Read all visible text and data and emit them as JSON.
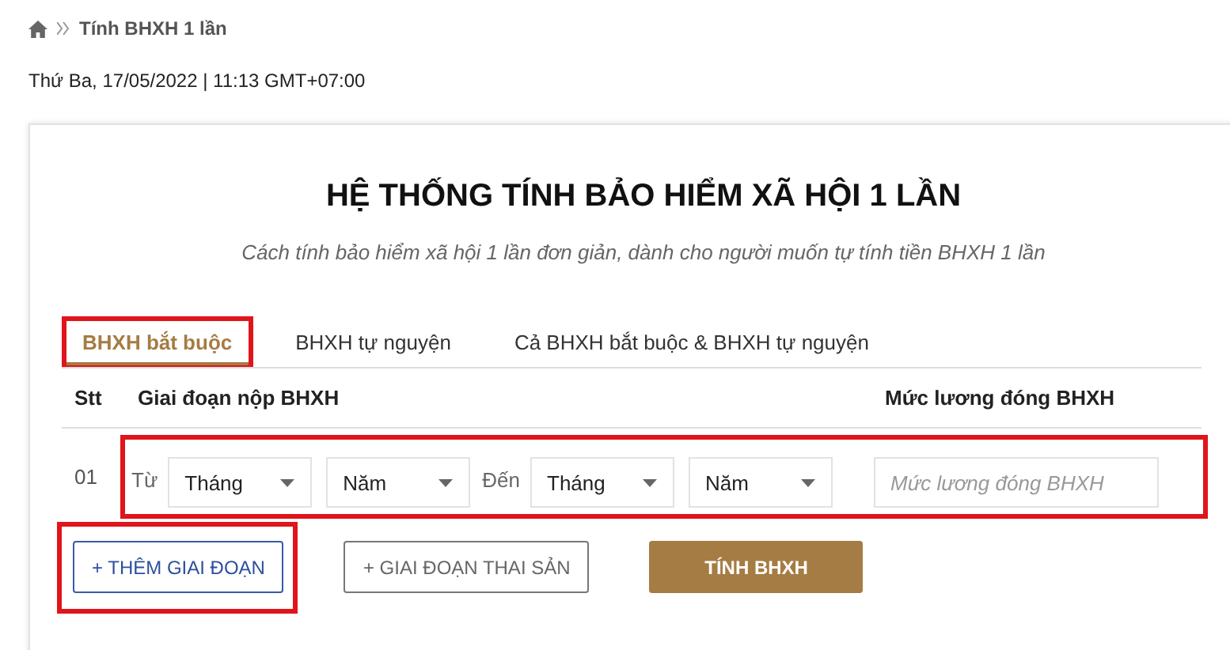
{
  "breadcrumb": {
    "current": "Tính BHXH 1 lần"
  },
  "date": "Thứ Ba, 17/05/2022 | 11:13 GMT+07:00",
  "title": "HỆ THỐNG TÍNH BẢO HIỂM XÃ HỘI 1 LẦN",
  "subtitle": "Cách tính bảo hiểm xã hội 1 lần đơn giản, dành cho người muốn tự tính tiền BHXH 1 lần",
  "tabs": [
    {
      "label": "BHXH bắt buộc",
      "selected": true,
      "highlighted": true
    },
    {
      "label": "BHXH tự nguyện",
      "selected": false,
      "highlighted": false
    },
    {
      "label": "Cả BHXH bắt buộc & BHXH tự nguyện",
      "selected": false,
      "highlighted": false
    }
  ],
  "table": {
    "columns": [
      "Stt",
      "Giai đoạn nộp BHXH",
      "Mức lương đóng BHXH"
    ],
    "rows": [
      {
        "stt": "01",
        "highlighted": true,
        "from_label": "Từ",
        "from_month": "Tháng",
        "from_year": "Năm",
        "to_label": "Đến",
        "to_month": "Tháng",
        "to_year": "Năm",
        "salary_placeholder": "Mức lương đóng BHXH"
      }
    ]
  },
  "buttons": [
    {
      "label": "+ THÊM GIAI ĐOẠN",
      "kind": "outline-blue",
      "highlighted": true
    },
    {
      "label": "+ GIAI ĐOẠN THAI SẢN",
      "kind": "outline-grey",
      "highlighted": false
    },
    {
      "label": "TÍNH BHXH",
      "kind": "primary",
      "highlighted": false
    }
  ]
}
